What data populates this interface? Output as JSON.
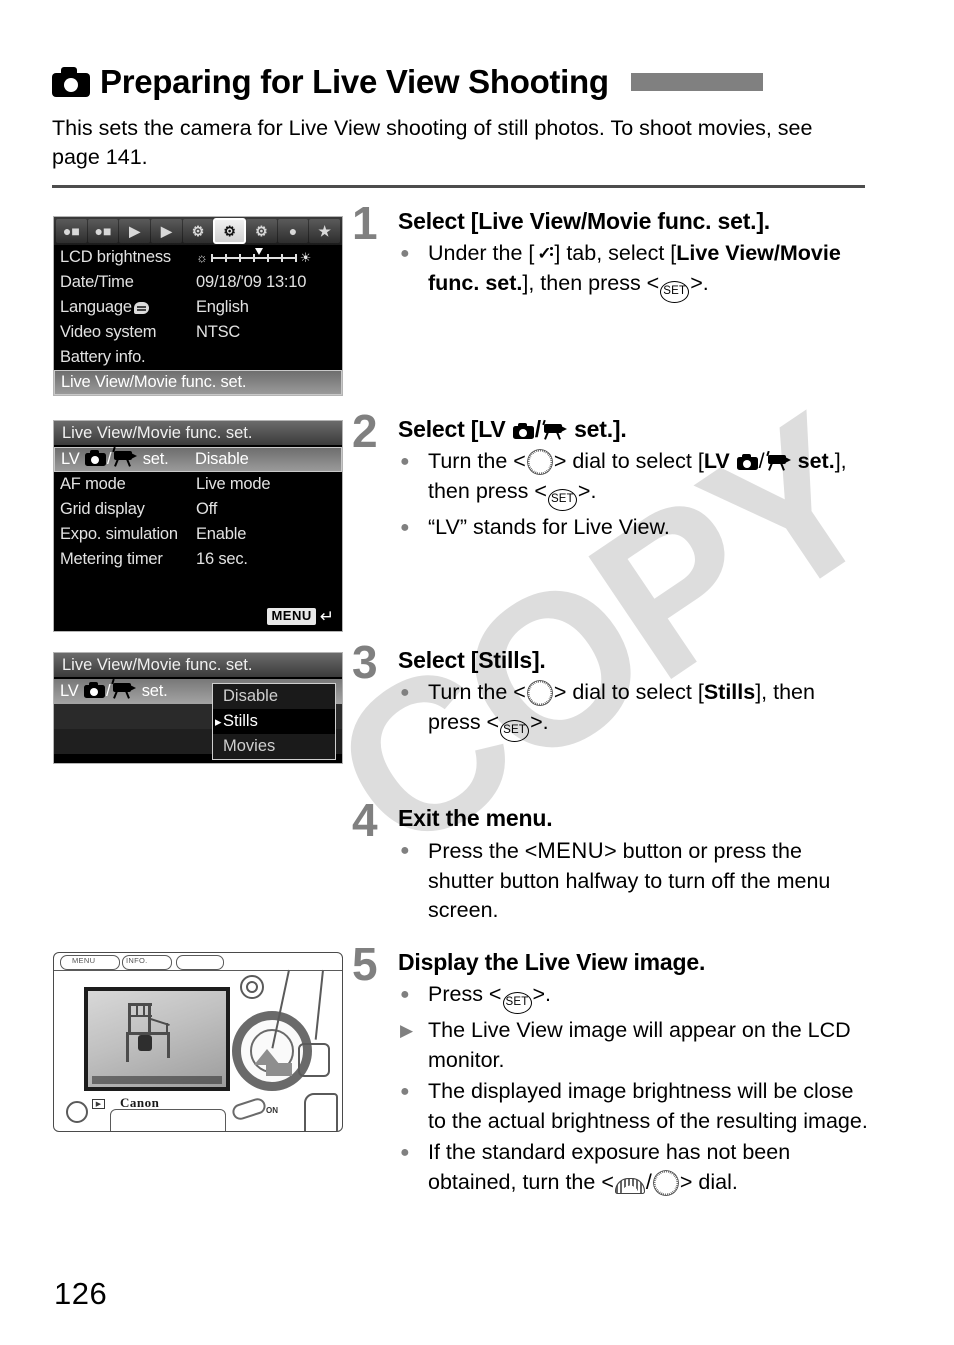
{
  "page": {
    "number": "126",
    "title": "Preparing for Live View Shooting",
    "title_icon": "camera-icon",
    "intro": "This sets the camera for Live View shooting of still photos. To shoot movies, see page 141.",
    "watermark": "COPY",
    "accent_bar_color": "#808080",
    "rule_color": "#4d4d4d"
  },
  "menu_screen_1": {
    "name": "setup-menu",
    "tabs": [
      {
        "name": "shooting-tab-1",
        "glyph": "●■",
        "active": false
      },
      {
        "name": "shooting-tab-2",
        "glyph": "●■",
        "active": false
      },
      {
        "name": "playback-tab-1",
        "glyph": "▶",
        "active": false
      },
      {
        "name": "playback-tab-2",
        "glyph": "▶",
        "active": false
      },
      {
        "name": "setup-tab-1",
        "glyph": "⚙",
        "active": false
      },
      {
        "name": "setup-tab-2",
        "glyph": "⚙",
        "active": true
      },
      {
        "name": "setup-tab-3",
        "glyph": "⚙",
        "active": false
      },
      {
        "name": "custom-functions-tab",
        "glyph": "●",
        "active": false
      },
      {
        "name": "my-menu-tab",
        "glyph": "★",
        "active": false
      }
    ],
    "rows": [
      {
        "label": "LCD brightness",
        "value": "",
        "type": "slider",
        "highlight": false
      },
      {
        "label": "Date/Time",
        "value": "09/18/'09 13:10",
        "highlight": false
      },
      {
        "label": "Language",
        "value": "English",
        "icon": "speech-bubble-icon",
        "highlight": false
      },
      {
        "label": "Video system",
        "value": "NTSC",
        "highlight": false
      },
      {
        "label": "Battery info.",
        "value": "",
        "highlight": false
      },
      {
        "label": "Live View/Movie func. set.",
        "value": "",
        "highlight": true
      }
    ]
  },
  "menu_screen_2": {
    "name": "live-view-movie-func-set-screen",
    "title": "Live View/Movie func. set.",
    "rows": [
      {
        "label": "LV",
        "label_suffix": "set.",
        "icons": [
          "camera-icon",
          "movie-icon"
        ],
        "value": "Disable",
        "highlight": true
      },
      {
        "label": "AF mode",
        "value": "Live mode",
        "highlight": false
      },
      {
        "label": "Grid display",
        "value": "Off",
        "highlight": false
      },
      {
        "label": "Expo. simulation",
        "value": "Enable",
        "highlight": false
      },
      {
        "label": "Metering timer",
        "value": "16 sec.",
        "highlight": false
      }
    ],
    "return_badge": "MENU",
    "return_arrow": "↵"
  },
  "menu_screen_3": {
    "name": "lv-set-dropdown-screen",
    "title": "Live View/Movie func. set.",
    "row": {
      "label": "LV",
      "label_suffix": "set.",
      "icons": [
        "camera-icon",
        "movie-icon"
      ]
    },
    "options": [
      {
        "label": "Disable",
        "selected": false
      },
      {
        "label": "Stills",
        "selected": true
      },
      {
        "label": "Movies",
        "selected": false
      }
    ]
  },
  "camera_photo": {
    "name": "camera-back-photo",
    "brand": "Canon",
    "button_labels": [
      "MENU",
      "INFO."
    ],
    "power_label": "ON",
    "lcd_content": "live-view-chair-image"
  },
  "steps": [
    {
      "number": "1",
      "heading": "Select [Live View/Movie func. set.].",
      "bullets": [
        {
          "marker": "dot",
          "parts": [
            {
              "t": "text",
              "v": "Under the ["
            },
            {
              "t": "icon",
              "v": "wrench-tab-icon"
            },
            {
              "t": "text",
              "v": "] tab, select ["
            },
            {
              "t": "bold",
              "v": "Live View/Movie func. set."
            },
            {
              "t": "text",
              "v": "], then press <"
            },
            {
              "t": "icon",
              "v": "set-button-icon"
            },
            {
              "t": "text",
              "v": ">."
            }
          ]
        }
      ]
    },
    {
      "number": "2",
      "heading_parts": [
        {
          "t": "text",
          "v": "Select [LV "
        },
        {
          "t": "icon",
          "v": "camera-icon"
        },
        {
          "t": "text",
          "v": "/"
        },
        {
          "t": "icon",
          "v": "movie-icon"
        },
        {
          "t": "text",
          "v": " set.]."
        }
      ],
      "bullets": [
        {
          "marker": "dot",
          "parts": [
            {
              "t": "text",
              "v": "Turn the <"
            },
            {
              "t": "icon",
              "v": "quick-control-dial-icon"
            },
            {
              "t": "text",
              "v": "> dial to select ["
            },
            {
              "t": "bold",
              "v": "LV "
            },
            {
              "t": "icon",
              "v": "camera-icon"
            },
            {
              "t": "text",
              "v": "/"
            },
            {
              "t": "icon",
              "v": "movie-icon"
            },
            {
              "t": "bold",
              "v": " set."
            },
            {
              "t": "text",
              "v": "], then press <"
            },
            {
              "t": "icon",
              "v": "set-button-icon"
            },
            {
              "t": "text",
              "v": ">."
            }
          ]
        },
        {
          "marker": "dot",
          "parts": [
            {
              "t": "text",
              "v": "“LV” stands for Live View."
            }
          ]
        }
      ]
    },
    {
      "number": "3",
      "heading": "Select [Stills].",
      "bullets": [
        {
          "marker": "dot",
          "parts": [
            {
              "t": "text",
              "v": "Turn the <"
            },
            {
              "t": "icon",
              "v": "quick-control-dial-icon"
            },
            {
              "t": "text",
              "v": "> dial to select ["
            },
            {
              "t": "bold",
              "v": "Stills"
            },
            {
              "t": "text",
              "v": "], then press <"
            },
            {
              "t": "icon",
              "v": "set-button-icon"
            },
            {
              "t": "text",
              "v": ">."
            }
          ]
        }
      ]
    },
    {
      "number": "4",
      "heading": "Exit the menu.",
      "bullets": [
        {
          "marker": "dot",
          "parts": [
            {
              "t": "text",
              "v": "Press the <"
            },
            {
              "t": "menuword",
              "v": "MENU"
            },
            {
              "t": "text",
              "v": "> button or press the shutter button halfway to turn off the menu screen."
            }
          ]
        }
      ]
    },
    {
      "number": "5",
      "heading": "Display the Live View image.",
      "bullets": [
        {
          "marker": "dot",
          "parts": [
            {
              "t": "text",
              "v": "Press <"
            },
            {
              "t": "icon",
              "v": "set-button-icon"
            },
            {
              "t": "text",
              "v": ">."
            }
          ]
        },
        {
          "marker": "triangle",
          "parts": [
            {
              "t": "text",
              "v": "The Live View image will appear on the LCD monitor."
            }
          ]
        },
        {
          "marker": "dot",
          "parts": [
            {
              "t": "text",
              "v": "The displayed image brightness will be close to the actual brightness of the resulting image."
            }
          ]
        },
        {
          "marker": "dot",
          "parts": [
            {
              "t": "text",
              "v": "If the standard exposure has not been obtained, turn the <"
            },
            {
              "t": "icon",
              "v": "main-dial-icon"
            },
            {
              "t": "text",
              "v": "/"
            },
            {
              "t": "icon",
              "v": "quick-control-dial-icon"
            },
            {
              "t": "text",
              "v": "> dial."
            }
          ]
        }
      ]
    }
  ]
}
